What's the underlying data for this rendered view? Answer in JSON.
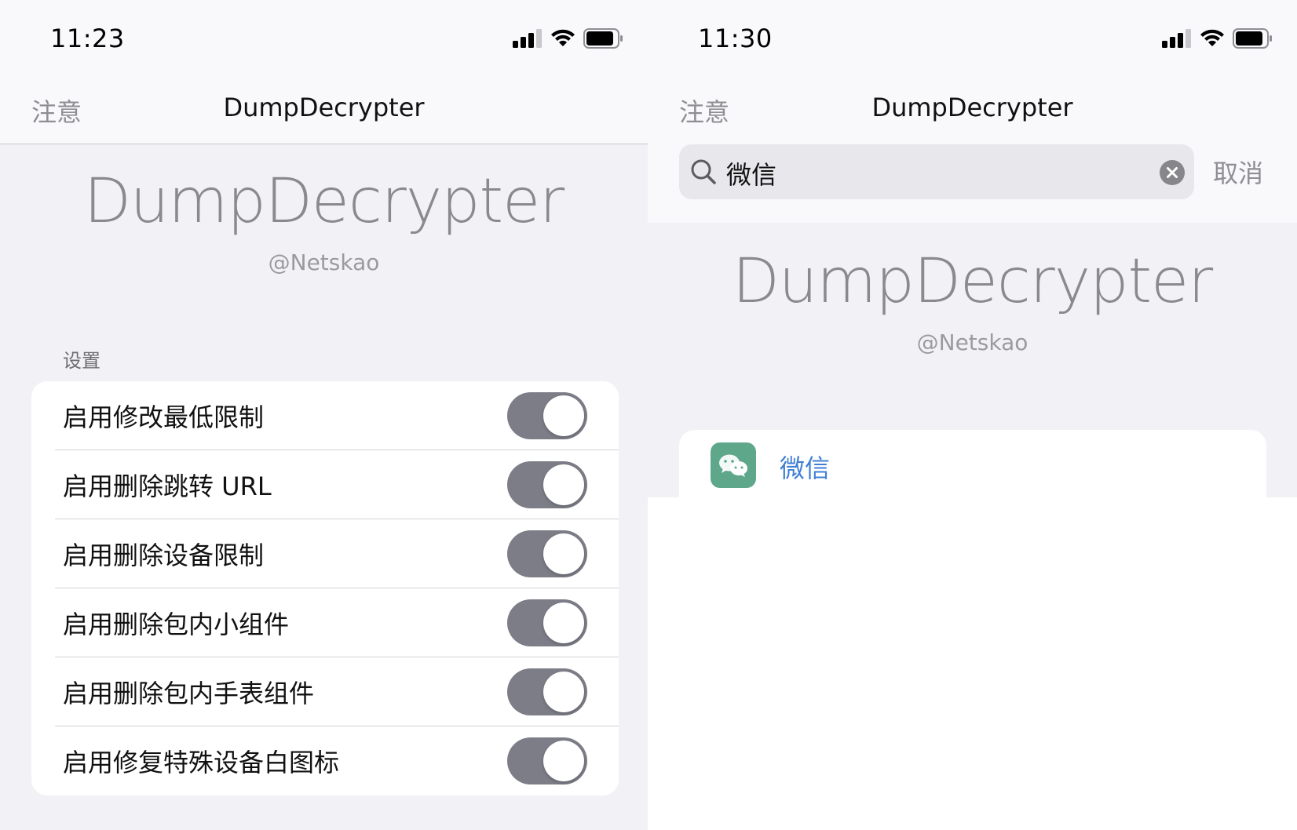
{
  "left": {
    "status": {
      "time": "11:23"
    },
    "nav": {
      "left": "注意",
      "title": "DumpDecrypter"
    },
    "hero": {
      "title": "DumpDecrypter",
      "subtitle": "@Netskao"
    },
    "section_header": "设置",
    "settings": [
      {
        "label": "启用修改最低限制",
        "on": false
      },
      {
        "label": "启用删除跳转 URL",
        "on": false
      },
      {
        "label": "启用删除设备限制",
        "on": false
      },
      {
        "label": "启用删除包内小组件",
        "on": false
      },
      {
        "label": "启用删除包内手表组件",
        "on": false
      },
      {
        "label": "启用修复特殊设备白图标",
        "on": false
      }
    ]
  },
  "right": {
    "status": {
      "time": "11:30"
    },
    "nav": {
      "left": "注意",
      "title": "DumpDecrypter"
    },
    "search": {
      "value": "微信",
      "cancel": "取消"
    },
    "hero": {
      "title": "DumpDecrypter",
      "subtitle": "@Netskao"
    },
    "results": [
      {
        "label": "微信",
        "icon": "wechat-app-icon"
      }
    ]
  },
  "colors": {
    "toggle_track": "#7c7d87",
    "link_blue": "#3f7fd4",
    "wechat_green": "#5fa78a",
    "background_gray": "#f2f2f6"
  }
}
